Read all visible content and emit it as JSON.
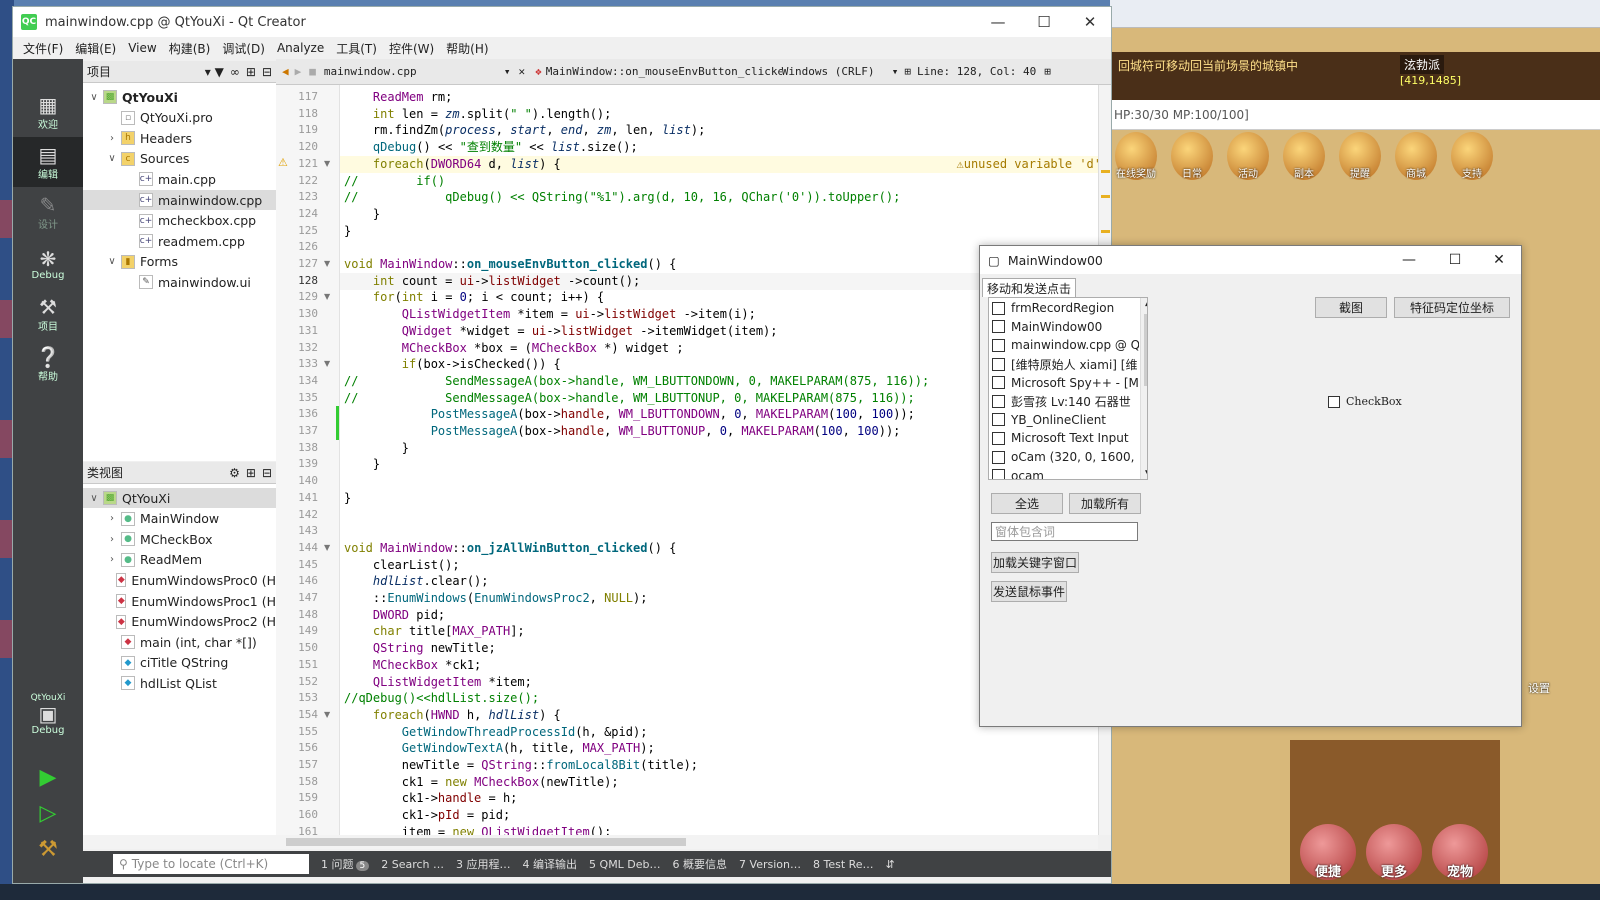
{
  "qt": {
    "title": "mainwindow.cpp @ QtYouXi - Qt Creator",
    "logo": "QC",
    "menu": [
      "文件(F)",
      "编辑(E)",
      "View",
      "构建(B)",
      "调试(D)",
      "Analyze",
      "工具(T)",
      "控件(W)",
      "帮助(H)"
    ],
    "modes": [
      {
        "label": "欢迎",
        "icon": "grid-icon"
      },
      {
        "label": "编辑",
        "icon": "edit-icon"
      },
      {
        "label": "设计",
        "icon": "pencil-icon"
      },
      {
        "label": "Debug",
        "icon": "bug-icon"
      },
      {
        "label": "项目",
        "icon": "wrench-icon"
      },
      {
        "label": "帮助",
        "icon": "help-icon"
      }
    ],
    "kit_label": "QtYouXi",
    "kit_mode": "Debug"
  },
  "projects": {
    "header": "项目",
    "tree": [
      {
        "label": "QtYouXi",
        "depth": 0,
        "twisty": "v",
        "icon": "project-icon",
        "bold": true
      },
      {
        "label": "QtYouXi.pro",
        "depth": 1,
        "twisty": "",
        "icon": "pro-file-icon"
      },
      {
        "label": "Headers",
        "depth": 1,
        "twisty": ">",
        "icon": "headers-folder-icon"
      },
      {
        "label": "Sources",
        "depth": 1,
        "twisty": "v",
        "icon": "sources-folder-icon"
      },
      {
        "label": "main.cpp",
        "depth": 2,
        "twisty": "",
        "icon": "cpp-file-icon"
      },
      {
        "label": "mainwindow.cpp",
        "depth": 2,
        "twisty": "",
        "icon": "cpp-file-icon",
        "selected": true
      },
      {
        "label": "mcheckbox.cpp",
        "depth": 2,
        "twisty": "",
        "icon": "cpp-file-icon"
      },
      {
        "label": "readmem.cpp",
        "depth": 2,
        "twisty": "",
        "icon": "cpp-file-icon"
      },
      {
        "label": "Forms",
        "depth": 1,
        "twisty": "v",
        "icon": "forms-folder-icon"
      },
      {
        "label": "mainwindow.ui",
        "depth": 2,
        "twisty": "",
        "icon": "ui-file-icon"
      }
    ]
  },
  "classview": {
    "header": "类视图",
    "tree": [
      {
        "label": "QtYouXi",
        "depth": 0,
        "twisty": "v",
        "icon": "project-icon",
        "selected": true
      },
      {
        "label": "MainWindow",
        "depth": 1,
        "twisty": ">",
        "icon": "class-icon"
      },
      {
        "label": "MCheckBox",
        "depth": 1,
        "twisty": ">",
        "icon": "class-icon"
      },
      {
        "label": "ReadMem",
        "depth": 1,
        "twisty": ">",
        "icon": "class-icon"
      },
      {
        "label": "EnumWindowsProc0 (H",
        "depth": 1,
        "twisty": "",
        "icon": "function-icon"
      },
      {
        "label": "EnumWindowsProc1 (H",
        "depth": 1,
        "twisty": "",
        "icon": "function-icon"
      },
      {
        "label": "EnumWindowsProc2 (H",
        "depth": 1,
        "twisty": "",
        "icon": "function-icon"
      },
      {
        "label": "main (int, char *[])",
        "depth": 1,
        "twisty": "",
        "icon": "function-icon"
      },
      {
        "label": "ciTitle QString",
        "depth": 1,
        "twisty": "",
        "icon": "variable-icon"
      },
      {
        "label": "hdlList QList",
        "depth": 1,
        "twisty": "",
        "icon": "variable-icon"
      }
    ]
  },
  "editor": {
    "file": "mainwindow.cpp",
    "symbol": "MainWindow::on_mouseEnvButton_clicke…",
    "line_ending": "Windows (CRLF)",
    "position": "Line: 128, Col: 40",
    "warning": "unused variable 'd'",
    "lines": [
      {
        "n": "117",
        "html": "    <span class='ty'>ReadMem</span> rm;"
      },
      {
        "n": "118",
        "html": "    <span class='kw'>int</span> len = <span class='it'>zm</span>.split(<span class='str'>\" \"</span>).length();"
      },
      {
        "n": "119",
        "html": "    rm.findZm(<span class='it'>process</span>, <span class='it'>start</span>, <span class='it'>end</span>, <span class='it'>zm</span>, len, <span class='it'>list</span>);"
      },
      {
        "n": "120",
        "html": "    <span class='fn'>qDebug</span>() &lt;&lt; <span class='str'>\"查到数量\"</span> &lt;&lt; <span class='it'>list</span>.size();"
      },
      {
        "n": "121",
        "html": "    <span class='kw'>foreach</span>(<span class='ty'>DWORD64</span> d, <span class='it'>list</span>) {",
        "fold": true,
        "warn": true
      },
      {
        "n": "122",
        "html": "<span class='cm'>//        if()</span>"
      },
      {
        "n": "123",
        "html": "<span class='cm'>//            qDebug() &lt;&lt; QString(\"%1\").arg(d, 10, 16, QChar('0')).toUpper();</span>"
      },
      {
        "n": "124",
        "html": "    }"
      },
      {
        "n": "125",
        "html": "}"
      },
      {
        "n": "126",
        "html": ""
      },
      {
        "n": "127",
        "html": "<span class='kw'>void</span> <span class='ty'>MainWindow</span>::<span class='fnb'>on_mouseEnvButton_clicked</span>() {",
        "fold": true
      },
      {
        "n": "128",
        "html": "    <span class='kw'>int</span> count = <span class='mem'>ui</span>-&gt;<span class='mem'>listWidget</span> -&gt;count();",
        "cur": true
      },
      {
        "n": "129",
        "html": "    <span class='kw'>for</span>(<span class='kw'>int</span> i = <span class='num'>0</span>; i &lt; count; i++) {",
        "fold": true
      },
      {
        "n": "130",
        "html": "        <span class='ty'>QListWidgetItem</span> *item = <span class='mem'>ui</span>-&gt;<span class='mem'>listWidget</span> -&gt;item(i);"
      },
      {
        "n": "131",
        "html": "        <span class='ty'>QWidget</span> *widget = <span class='mem'>ui</span>-&gt;<span class='mem'>listWidget</span> -&gt;itemWidget(item);"
      },
      {
        "n": "132",
        "html": "        <span class='ty'>MCheckBox</span> *box = (<span class='ty'>MCheckBox</span> *) widget ;"
      },
      {
        "n": "133",
        "html": "        <span class='kw'>if</span>(box-&gt;isChecked()) {",
        "fold": true
      },
      {
        "n": "134",
        "html": "<span class='cm'>//            SendMessageA(box-&gt;handle, WM_LBUTTONDOWN, 0, MAKELPARAM(875, 116));</span>"
      },
      {
        "n": "135",
        "html": "<span class='cm'>//            SendMessageA(box-&gt;handle, WM_LBUTTONUP, 0, MAKELPARAM(875, 116));</span>"
      },
      {
        "n": "136",
        "html": "            <span class='fn'>PostMessageA</span>(box-&gt;<span class='mem'>handle</span>, <span class='ty'>WM_LBUTTONDOWN</span>, <span class='num'>0</span>, <span class='ty'>MAKELPARAM</span>(<span class='num'>100</span>, <span class='num'>100</span>));"
      },
      {
        "n": "137",
        "html": "            <span class='fn'>PostMessageA</span>(box-&gt;<span class='mem'>handle</span>, <span class='ty'>WM_LBUTTONUP</span>, <span class='num'>0</span>, <span class='ty'>MAKELPARAM</span>(<span class='num'>100</span>, <span class='num'>100</span>));"
      },
      {
        "n": "138",
        "html": "        }"
      },
      {
        "n": "139",
        "html": "    }"
      },
      {
        "n": "140",
        "html": ""
      },
      {
        "n": "141",
        "html": "}"
      },
      {
        "n": "142",
        "html": ""
      },
      {
        "n": "143",
        "html": ""
      },
      {
        "n": "144",
        "html": "<span class='kw'>void</span> <span class='ty'>MainWindow</span>::<span class='fnb'>on_jzAllWinButton_clicked</span>() {",
        "fold": true
      },
      {
        "n": "145",
        "html": "    clearList();"
      },
      {
        "n": "146",
        "html": "    <span class='it'>hdlList</span>.clear();"
      },
      {
        "n": "147",
        "html": "    ::<span class='fn'>EnumWindows</span>(<span class='fn'>EnumWindowsProc2</span>, <span class='kw'>NULL</span>);"
      },
      {
        "n": "148",
        "html": "    <span class='ty'>DWORD</span> pid;"
      },
      {
        "n": "149",
        "html": "    <span class='kw'>char</span> title[<span class='ty'>MAX_PATH</span>];"
      },
      {
        "n": "150",
        "html": "    <span class='ty'>QString</span> newTitle;"
      },
      {
        "n": "151",
        "html": "    <span class='ty'>MCheckBox</span> *ck1;"
      },
      {
        "n": "152",
        "html": "    <span class='ty'>QListWidgetItem</span> *item;"
      },
      {
        "n": "153",
        "html": "<span class='cm'>//qDebug()&lt;&lt;hdlList.size();</span>"
      },
      {
        "n": "154",
        "html": "    <span class='kw'>foreach</span>(<span class='ty'>HWND</span> h, <span class='it'>hdlList</span>) {",
        "fold": true
      },
      {
        "n": "155",
        "html": "        <span class='fn'>GetWindowThreadProcessId</span>(h, &amp;pid);"
      },
      {
        "n": "156",
        "html": "        <span class='fn'>GetWindowTextA</span>(h, title, <span class='ty'>MAX_PATH</span>);"
      },
      {
        "n": "157",
        "html": "        newTitle = <span class='ty'>QString</span>::<span class='fn'>fromLocal8Bit</span>(title);"
      },
      {
        "n": "158",
        "html": "        ck1 = <span class='kw'>new</span> <span class='ty'>MCheckBox</span>(newTitle);"
      },
      {
        "n": "159",
        "html": "        ck1-&gt;<span class='mem'>handle</span> = h;"
      },
      {
        "n": "160",
        "html": "        ck1-&gt;<span class='mem'>pId</span> = pid;"
      },
      {
        "n": "161",
        "html": "        item = <span class='kw'>new</span> <span class='ty'>QListWidgetItem</span>();"
      }
    ]
  },
  "statusbar": {
    "locator_placeholder": "Type to locate (Ctrl+K)",
    "tabs": [
      {
        "n": "1",
        "label": "问题",
        "badge": "5"
      },
      {
        "n": "2",
        "label": "Search …"
      },
      {
        "n": "3",
        "label": "应用程…"
      },
      {
        "n": "4",
        "label": "编译输出"
      },
      {
        "n": "5",
        "label": "QML Deb…"
      },
      {
        "n": "6",
        "label": "概要信息"
      },
      {
        "n": "7",
        "label": "Version…"
      },
      {
        "n": "8",
        "label": "Test Re…"
      }
    ]
  },
  "dialog": {
    "title": "MainWindow00",
    "tab": "移动和发送点击",
    "items": [
      "frmRecordRegion",
      "MainWindow00",
      "mainwindow.cpp @ Q",
      "[维特原始人 xiami] [维",
      "Microsoft Spy++ - [M",
      "彭雪孩 Lv:140  石器世",
      "YB_OnlineClient",
      "Microsoft Text Input",
      "oCam (320, 0, 1600, 9",
      "ocam"
    ],
    "select_all": "全选",
    "load_all": "加载所有",
    "keyword_placeholder": "窗体包含词",
    "load_keyword": "加载关键字窗口",
    "send_mouse": "发送鼠标事件",
    "screenshot": "截图",
    "locate": "特征码定位坐标",
    "checkbox": "CheckBox"
  },
  "game": {
    "banner": "回城符可移动回当前场景的城镇中",
    "top_right": "泫勃派",
    "coords": "[419,1485]",
    "hp": "HP:30/30 MP:100/100]",
    "icons": [
      "在线奖励",
      "日常",
      "活动",
      "副本",
      "提醒",
      "商城",
      "支持"
    ],
    "bottom": [
      "便捷",
      "更多",
      "宠物"
    ],
    "settings": "设置"
  }
}
